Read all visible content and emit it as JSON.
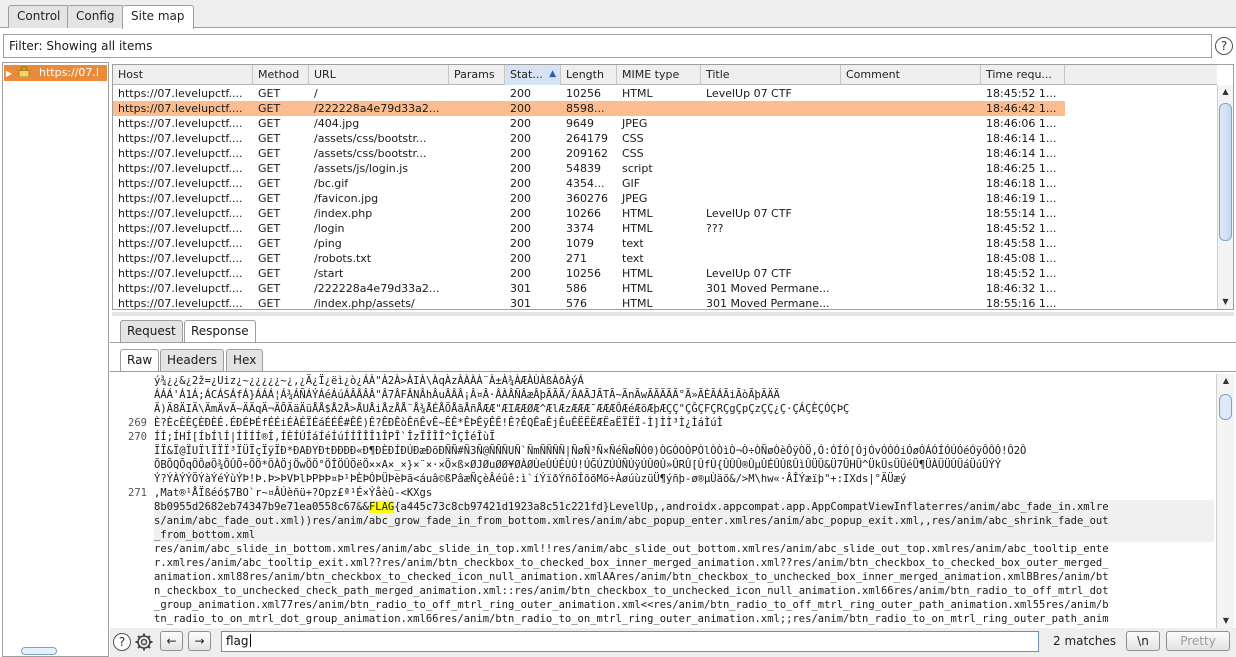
{
  "top_tabs": [
    "Control",
    "Config",
    "Site map"
  ],
  "filter_text": "Filter: Showing all items",
  "tree": {
    "item_label": "https://07.l"
  },
  "table": {
    "columns": [
      "Host",
      "Method",
      "URL",
      "Params",
      "Status",
      "Length",
      "MIME type",
      "Title",
      "Comment",
      "Time requested"
    ],
    "column_labels": [
      "Host",
      "Method",
      "URL",
      "Params",
      "Stat...",
      "Length",
      "MIME type",
      "Title",
      "Comment",
      "Time requ..."
    ],
    "sorted_column": "Status",
    "selected_row": 1,
    "rows": [
      [
        "https://07.levelupctf....",
        "GET",
        "/",
        "",
        "200",
        "10256",
        "HTML",
        "LevelUp 07 CTF",
        "",
        "18:45:52 1..."
      ],
      [
        "https://07.levelupctf....",
        "GET",
        "/222228a4e79d33a2...",
        "",
        "200",
        "8598...",
        "",
        "",
        "",
        "18:46:42 1..."
      ],
      [
        "https://07.levelupctf....",
        "GET",
        "/404.jpg",
        "",
        "200",
        "9649",
        "JPEG",
        "",
        "",
        "18:46:06 1..."
      ],
      [
        "https://07.levelupctf....",
        "GET",
        "/assets/css/bootstr...",
        "",
        "200",
        "264179",
        "CSS",
        "",
        "",
        "18:46:14 1..."
      ],
      [
        "https://07.levelupctf....",
        "GET",
        "/assets/css/bootstr...",
        "",
        "200",
        "209162",
        "CSS",
        "",
        "",
        "18:46:14 1..."
      ],
      [
        "https://07.levelupctf....",
        "GET",
        "/assets/js/login.js",
        "",
        "200",
        "54839",
        "script",
        "",
        "",
        "18:46:25 1..."
      ],
      [
        "https://07.levelupctf....",
        "GET",
        "/bc.gif",
        "",
        "200",
        "4354...",
        "GIF",
        "",
        "",
        "18:46:18 1..."
      ],
      [
        "https://07.levelupctf....",
        "GET",
        "/favicon.jpg",
        "",
        "200",
        "360276",
        "JPEG",
        "",
        "",
        "18:46:19 1..."
      ],
      [
        "https://07.levelupctf....",
        "GET",
        "/index.php",
        "",
        "200",
        "10266",
        "HTML",
        "LevelUp 07 CTF",
        "",
        "18:55:14 1..."
      ],
      [
        "https://07.levelupctf....",
        "GET",
        "/login",
        "",
        "200",
        "3374",
        "HTML",
        "???",
        "",
        "18:45:52 1..."
      ],
      [
        "https://07.levelupctf....",
        "GET",
        "/ping",
        "",
        "200",
        "1079",
        "text",
        "",
        "",
        "18:45:58 1..."
      ],
      [
        "https://07.levelupctf....",
        "GET",
        "/robots.txt",
        "",
        "200",
        "271",
        "text",
        "",
        "",
        "18:45:08 1..."
      ],
      [
        "https://07.levelupctf....",
        "GET",
        "/start",
        "",
        "200",
        "10256",
        "HTML",
        "LevelUp 07 CTF",
        "",
        "18:45:52 1..."
      ],
      [
        "https://07.levelupctf....",
        "GET",
        "/222228a4e79d33a2...",
        "",
        "301",
        "586",
        "HTML",
        "301 Moved Permane...",
        "",
        "18:46:32 1..."
      ],
      [
        "https://07.levelupctf....",
        "GET",
        "/index.php/assets/",
        "",
        "301",
        "576",
        "HTML",
        "301 Moved Permane...",
        "",
        "18:55:16 1..."
      ]
    ]
  },
  "message_tabs": [
    "Request",
    "Response"
  ],
  "view_tabs": [
    "Raw",
    "Headers",
    "Hex"
  ],
  "response_lines": [
    {
      "num": "",
      "text": "ý¾¿¿&¿2ž=¿Uiz¿~¿¿¿¿¿~¿,¿Ä¿Ï¿ëì¿ò¿ÁÀ\"À2À>ÀIÀ\\ÀqÀzÀÀÀÀ¨À±À¾ÀÆÀÙÀßÀðÀýÁ"
    },
    {
      "num": "",
      "text": "ÁÁÁ'Á1Á;ÁCÁSÁfÁ}ÁÁÁ¦Á¾ÁÑÁÝÁéÁúÁÂÂÂÂ\"Â7ÂFÂNÂhÂuÂÂÂ¡Â¤Â·ÂÀÂÑÂæÂþÃÃÃ/ÃAÃJÃTÃ~ÃnÃwÃÃÃÃÃ°Ã»ÃÈÃÁÃiÃòÃþÃÄÄ"
    },
    {
      "num": "",
      "text": "Ä)Ä8ÄIÄ\\ÄmÄvÄ~ÄÄqÄ¬ÄÕÄäÄüÅÅ$Å2Å>ÅUÅiÅzÅÅ¨Å¾ÅÉÅÕÅãÅñÅÆÆ\"ÆIÆÆØÆ^ÆlÆzÆÆÆ¯ÆÆÆÔÆéÆõÆþÆÇÇ\"ÇĜÇFÇRÇgÇpÇzÇÇ¿Ç·ÇÁÇÈÇÓÇÞÇ"
    },
    {
      "num": "269",
      "text": "È?ÈcÈÈÇÈÐÈÉ.ÉÐÉÞÉfÉÉiÉÀÉÏÉáÉÉÊ#ÊÊ)Ê?ÊÐÊòÊñÊvÊ~ÊÊ*ÊÞÊÿÊÊ!Ê?ÊQÊaÊjÊuÊËËËÆËaËÏËÏ-Ì]ÌÌ³Ì¿ÌáÌúÌ"
    },
    {
      "num": "270",
      "text": "ÍÍ;ÍHÍ[ÍbÍlÍ|ÍÍÍÍ®Í,ÍÈÍÚÍáÍéÍúÍÍÎÎÎ1ÎPÎ`ÎzÎÎÎÎ^ÎÇÎéÎùÏ"
    },
    {
      "num": "",
      "text": "ÏÏ&Ï@ÏUÏlÏÏÏ³ÏÜÏçÏÿÏÐ*ÐAÐYÐtÐÐÐÐ«Ð¶ÐÈÐÍÐÚÐæÐõÐÑÑ#Ñ3Ñ@ÑÑÑUÑ`ÑmÑÑÑÑ|ÑøÑ³Ñ×ÑéÑøÑÒ0)ÒGÒOÒPÒlÒÒìÒ¬Ò÷ÒÑøÒèÔÿÒÖ,Ó:ÓÍÓ[ÓjÓvÓÓÓiÓøÓÁÓÍÓÚÓéÓÿÔÔÔ!Ô2Ô"
    },
    {
      "num": "",
      "text": "ÕBÕQÕqÕÕøÕ¾ÕÛÕ÷ÕÖ*ÖÀÖjÖwÖÖ°ÖÎÖÛÖëÖ××A×_×}×¨×·×Ö×ß×ØJØuØØ¥ØÀØÙeÙÚÉÙÙ!ÚĞÚZÚÚÑÚÿÚÛ0Û»ÛRÛ[ÛfÛ{ÛÛÛ®ÛµÛÉÛÛßÛìÛÜÜ&Ü7ÜHÜ^ÜkÜsÜÜéÜ¶ÜÀÜÜÛÜáÜúÜÝÝ"
    },
    {
      "num": "",
      "text": "Ý?ÝÀÝÝÕÝàÝéÝùÝÞ!Þ.Þ>ÞVÞlÞPÞÞ¤Þ¹ÞÈÞÓÞÜÞèÞã<áuâ©ßPâæÑçèÂéûê:ì`íÝïðÝñõÍõõMö÷ÀøúùzüÜ¶ýñþ-ø®µÙäõ&/>M\\hw«·ÂÎÝæïþ\"+:IXds|°ÄÜæý"
    },
    {
      "num": "271",
      "text": ",Mat®¹ÅÏßéó$7BO`r~¤ÂÚèñü+?Opz£ª¹É×Ýåèû-<KXgs"
    },
    {
      "num": "",
      "text": "8b0955d2682eb74347b9e71ea0558c67&&",
      "flag": "FLAG",
      "after": "{a445c73c8cb97421d1923a8c51c221fd}LevelUp,,androidx.appcompat.app.AppCompatViewInflaterres/anim/abc_fade_in.xmlre",
      "hl": true
    },
    {
      "num": "",
      "text": "s/anim/abc_fade_out.xml))res/anim/abc_grow_fade_in_from_bottom.xmlres/anim/abc_popup_enter.xmlres/anim/abc_popup_exit.xml,,res/anim/abc_shrink_fade_out",
      "hl": true
    },
    {
      "num": "",
      "text": "_from_bottom.xml",
      "hl": true
    },
    {
      "num": "",
      "text": "res/anim/abc_slide_in_bottom.xmlres/anim/abc_slide_in_top.xml!!res/anim/abc_slide_out_bottom.xmlres/anim/abc_slide_out_top.xmlres/anim/abc_tooltip_ente"
    },
    {
      "num": "",
      "text": "r.xmlres/anim/abc_tooltip_exit.xml??res/anim/btn_checkbox_to_checked_box_inner_merged_animation.xml??res/anim/btn_checkbox_to_checked_box_outer_merged_"
    },
    {
      "num": "",
      "text": "animation.xml88res/anim/btn_checkbox_to_checked_icon_null_animation.xmlAAres/anim/btn_checkbox_to_unchecked_box_inner_merged_animation.xmlBBres/anim/bt"
    },
    {
      "num": "",
      "text": "n_checkbox_to_unchecked_check_path_merged_animation.xml::res/anim/btn_checkbox_to_unchecked_icon_null_animation.xml66res/anim/btn_radio_to_off_mtrl_dot"
    },
    {
      "num": "",
      "text": "_group_animation.xml77res/anim/btn_radio_to_off_mtrl_ring_outer_animation.xml<<res/anim/btn_radio_to_off_mtrl_ring_outer_path_animation.xml55res/anim/b"
    },
    {
      "num": "",
      "text": "tn_radio_to_on_mtrl_dot_group_animation.xml66res/anim/btn_radio_to_on_mtrl_ring_outer_animation.xml;;res/anim/btn_radio_to_on_mtrl_ring_outer_path_anim"
    }
  ],
  "search": {
    "value": "flag",
    "matches": "2 matches",
    "newline_btn": "\\n",
    "pretty_btn": "Pretty"
  },
  "icons": {
    "help": "?",
    "back": "←",
    "forward": "→"
  }
}
